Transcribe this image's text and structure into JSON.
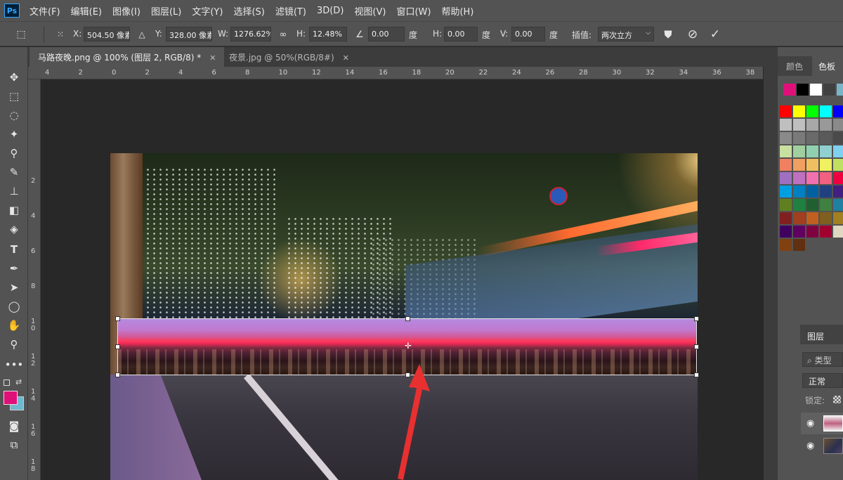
{
  "app": {
    "logo": "Ps"
  },
  "menu": [
    "文件(F)",
    "编辑(E)",
    "图像(I)",
    "图层(L)",
    "文字(Y)",
    "选择(S)",
    "滤镜(T)",
    "3D(D)",
    "视图(V)",
    "窗口(W)",
    "帮助(H)"
  ],
  "options": {
    "x_label": "X:",
    "x_value": "504.50 像素",
    "y_label": "Y:",
    "y_value": "328.00 像素",
    "w_label": "W:",
    "w_value": "1276.62%",
    "h_label": "H:",
    "h_value": "12.48%",
    "angle_value": "0.00",
    "angle_unit": "度",
    "hskew_label": "H:",
    "hskew_value": "0.00",
    "hskew_unit": "度",
    "vskew_label": "V:",
    "vskew_value": "0.00",
    "vskew_unit": "度",
    "interp_label": "插值:",
    "interp_value": "两次立方"
  },
  "tabs": [
    {
      "label": "马路夜晚.png @ 100% (图层 2, RGB/8) *",
      "active": true
    },
    {
      "label": "夜景.jpg @ 50%(RGB/8#)",
      "active": false
    }
  ],
  "ruler_top": [
    "4",
    "2",
    "0",
    "2",
    "4",
    "6",
    "8",
    "10",
    "12",
    "14",
    "16",
    "18",
    "20",
    "22",
    "24",
    "26",
    "28",
    "30",
    "32",
    "34",
    "36",
    "38"
  ],
  "ruler_left": [
    "2",
    "4",
    "6",
    "8",
    "10",
    "12",
    "14",
    "16",
    "18"
  ],
  "colors": {
    "foreground": "#e0107a",
    "background": "#6fb8d0",
    "accent_arrow": "#e83030"
  },
  "panel": {
    "tab_color": "颜色",
    "tab_swatches": "色板",
    "layers_tab": "图层",
    "search_placeholder": "类型",
    "blend_mode": "正常",
    "lock_label": "锁定:"
  },
  "swatch_top": [
    "#e0107a",
    "#000000",
    "#ffffff",
    "#404040",
    "#7ab4c8"
  ],
  "swatches": [
    [
      "#ff0000",
      "#ffff00",
      "#00ff00",
      "#00ffff",
      "#0000ff",
      "#ff00ff"
    ],
    [
      "#bfbfbf",
      "#bfbfbf",
      "#a8a8a8",
      "#999999",
      "#8a8a8a",
      "#ff0000"
    ],
    [
      "#8a8a8a",
      "#7a7a7a",
      "#6a6a6a",
      "#5a5a5a",
      "#4a4a4a",
      "#444444"
    ],
    [
      "#c8e0a0",
      "#a0d0a0",
      "#90d0b0",
      "#90d0d0",
      "#80d0f0",
      "#a0c0f0"
    ],
    [
      "#f08060",
      "#f0a060",
      "#f0c060",
      "#f0f060",
      "#c0e060",
      "#80e060"
    ],
    [
      "#a070c0",
      "#c070c0",
      "#f070b0",
      "#f06080",
      "#f00040",
      "#e00070"
    ],
    [
      "#00a0e0",
      "#0080c0",
      "#0060a0",
      "#204080",
      "#402080",
      "#602080"
    ],
    [
      "#608020",
      "#208040",
      "#206030",
      "#408040",
      "#2080a0",
      "#206090"
    ],
    [
      "#802020",
      "#a04020",
      "#c06020",
      "#806020",
      "#a08020",
      "#808000"
    ],
    [
      "#400060",
      "#600060",
      "#800040",
      "#a00030",
      "#e0d8c0",
      "#c0b8a0"
    ],
    [
      "#804010",
      "#603010"
    ]
  ]
}
